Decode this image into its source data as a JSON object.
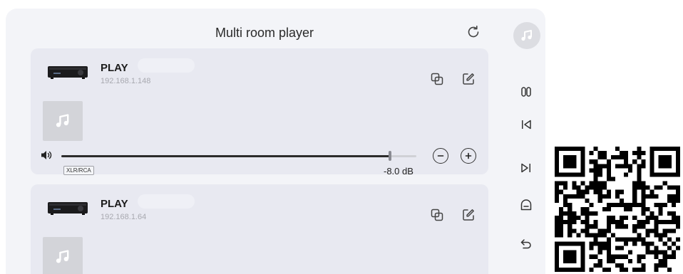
{
  "header": {
    "title": "Multi room player",
    "refresh_icon": "refresh-icon",
    "now_playing_icon": "music-note-icon"
  },
  "devices": [
    {
      "name": "PLAY",
      "ip": "192.168.1.148",
      "input": "XLR/RCA",
      "volume_label": "-8.0 dB",
      "volume_level": 0.925,
      "icons": [
        "group-icon",
        "edit-icon"
      ]
    },
    {
      "name": "PLAY",
      "ip": "192.168.1.64",
      "icons": [
        "group-icon",
        "edit-icon"
      ]
    }
  ],
  "sidebar": {
    "icons": [
      "pause-icon",
      "previous-icon",
      "next-icon",
      "home-icon",
      "back-icon"
    ]
  },
  "qr_code": "qr-code"
}
